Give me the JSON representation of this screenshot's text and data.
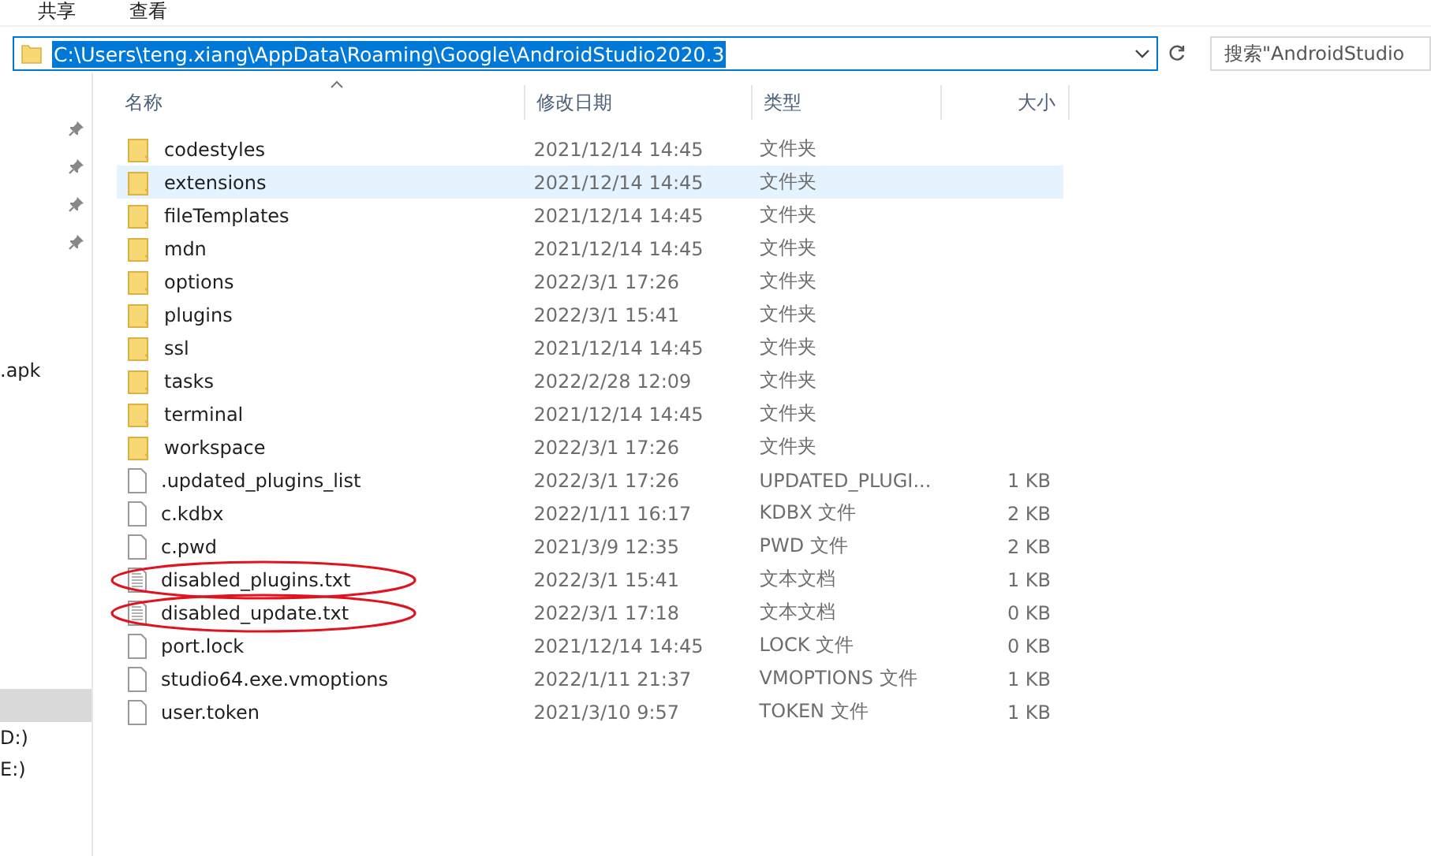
{
  "ribbon_tabs": [
    {
      "label": "共享"
    },
    {
      "label": "查看"
    }
  ],
  "address_bar": {
    "path": "C:\\Users\\teng.xiang\\AppData\\Roaming\\Google\\AndroidStudio2020.3"
  },
  "search": {
    "placeholder": "搜索\"AndroidStudio"
  },
  "sidebar": {
    "items": [
      {
        "text": ".apk",
        "selected": false
      },
      {
        "selected": true
      },
      {
        "text": "D:)",
        "selected": false
      },
      {
        "text": "E:)",
        "selected": false
      }
    ]
  },
  "table": {
    "columns": [
      "名称",
      "修改日期",
      "类型",
      "大小"
    ],
    "rows": [
      {
        "name": "codestyles",
        "date": "2021/12/14 14:45",
        "type": "文件夹",
        "kind": "folder",
        "hovered": false,
        "circled": false
      },
      {
        "name": "extensions",
        "date": "2021/12/14 14:45",
        "type": "文件夹",
        "kind": "folder",
        "hovered": true,
        "circled": false
      },
      {
        "name": "fileTemplates",
        "date": "2021/12/14 14:45",
        "type": "文件夹",
        "kind": "folder",
        "hovered": false,
        "circled": false
      },
      {
        "name": "mdn",
        "date": "2021/12/14 14:45",
        "type": "文件夹",
        "kind": "folder",
        "hovered": false,
        "circled": false
      },
      {
        "name": "options",
        "date": "2022/3/1 17:26",
        "type": "文件夹",
        "kind": "folder",
        "hovered": false,
        "circled": false
      },
      {
        "name": "plugins",
        "date": "2022/3/1 15:41",
        "type": "文件夹",
        "kind": "folder",
        "hovered": false,
        "circled": false
      },
      {
        "name": "ssl",
        "date": "2021/12/14 14:45",
        "type": "文件夹",
        "kind": "folder",
        "hovered": false,
        "circled": false
      },
      {
        "name": "tasks",
        "date": "2022/2/28 12:09",
        "type": "文件夹",
        "kind": "folder",
        "hovered": false,
        "circled": false
      },
      {
        "name": "terminal",
        "date": "2021/12/14 14:45",
        "type": "文件夹",
        "kind": "folder",
        "hovered": false,
        "circled": false
      },
      {
        "name": "workspace",
        "date": "2022/3/1 17:26",
        "type": "文件夹",
        "kind": "folder",
        "hovered": false,
        "circled": false
      },
      {
        "name": ".updated_plugins_list",
        "date": "2022/3/1 17:26",
        "type": "UPDATED_PLUGI...",
        "size": "1 KB",
        "kind": "file",
        "hovered": false,
        "circled": false
      },
      {
        "name": "c.kdbx",
        "date": "2022/1/11 16:17",
        "type": "KDBX 文件",
        "size": "2 KB",
        "kind": "file",
        "hovered": false,
        "circled": false
      },
      {
        "name": "c.pwd",
        "date": "2021/3/9 12:35",
        "type": "PWD 文件",
        "size": "2 KB",
        "kind": "file",
        "hovered": false,
        "circled": false
      },
      {
        "name": "disabled_plugins.txt",
        "date": "2022/3/1 15:41",
        "type": "文本文档",
        "size": "1 KB",
        "kind": "text",
        "hovered": false,
        "circled": true
      },
      {
        "name": "disabled_update.txt",
        "date": "2022/3/1 17:18",
        "type": "文本文档",
        "size": "0 KB",
        "kind": "text",
        "hovered": false,
        "circled": true
      },
      {
        "name": "port.lock",
        "date": "2021/12/14 14:45",
        "type": "LOCK 文件",
        "size": "0 KB",
        "kind": "file",
        "hovered": false,
        "circled": false
      },
      {
        "name": "studio64.exe.vmoptions",
        "date": "2022/1/11 21:37",
        "type": "VMOPTIONS 文件",
        "size": "1 KB",
        "kind": "file",
        "hovered": false,
        "circled": false
      },
      {
        "name": "user.token",
        "date": "2021/3/10 9:57",
        "type": "TOKEN 文件",
        "size": "1 KB",
        "kind": "file",
        "hovered": false,
        "circled": false
      }
    ]
  }
}
